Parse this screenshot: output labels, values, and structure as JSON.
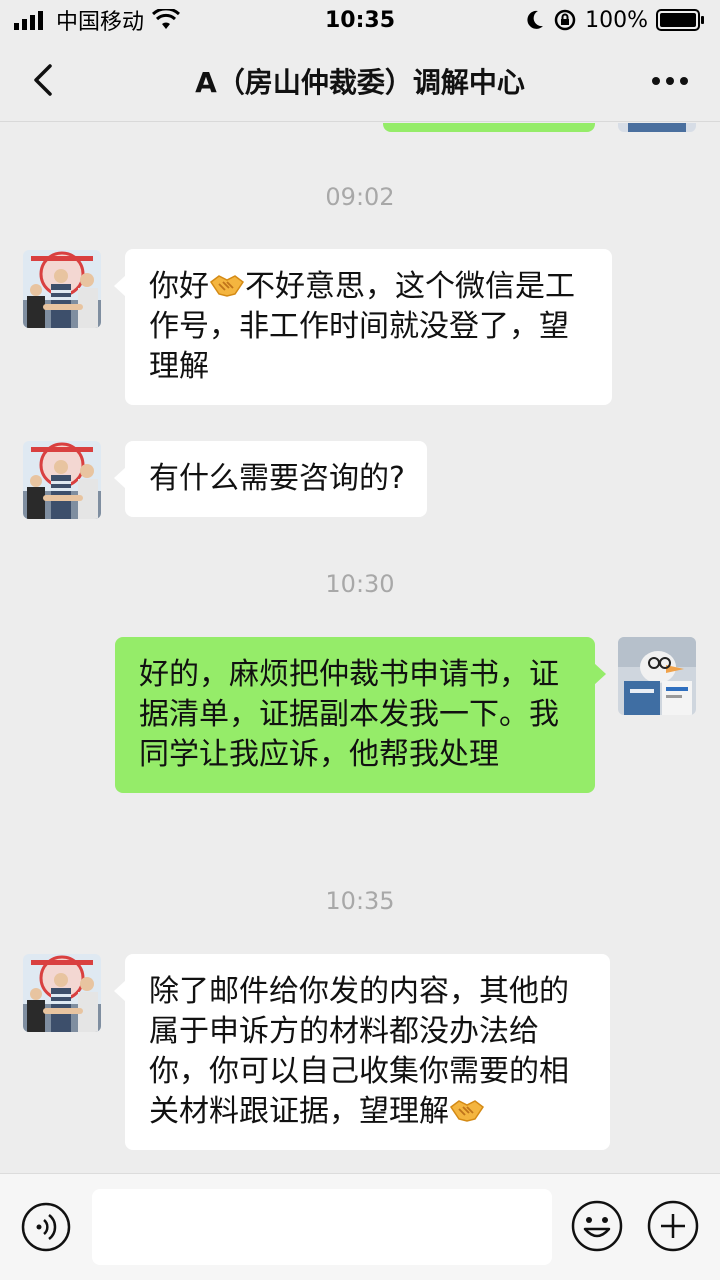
{
  "status_bar": {
    "carrier": "中国移动",
    "time": "10:35",
    "battery_percent": "100%"
  },
  "nav": {
    "title": "A（房山仲裁委）调解中心"
  },
  "chat": {
    "timestamps": [
      "09:02",
      "10:30",
      "10:35"
    ],
    "messages": [
      {
        "side": "in",
        "text_a": "你好",
        "icon": "handshake-icon",
        "text_b": "不好意思，这个微信是工作号，非工作时间就没登了，望理解"
      },
      {
        "side": "in",
        "text": "有什么需要咨询的?"
      },
      {
        "side": "out",
        "text": "好的，麻烦把仲裁书申请书，证据清单，证据副本发我一下。我同学让我应诉，他帮我处理"
      },
      {
        "side": "in",
        "text_a": "除了邮件给你发的内容，其他的属于申诉方的材料都没办法给你，你可以自己收集你需要的相关材料跟证据，望理解",
        "icon": "handshake-icon"
      }
    ]
  },
  "input": {
    "placeholder": ""
  },
  "colors": {
    "background": "#ededed",
    "bubble_in": "#ffffff",
    "bubble_out": "#95ec69"
  }
}
